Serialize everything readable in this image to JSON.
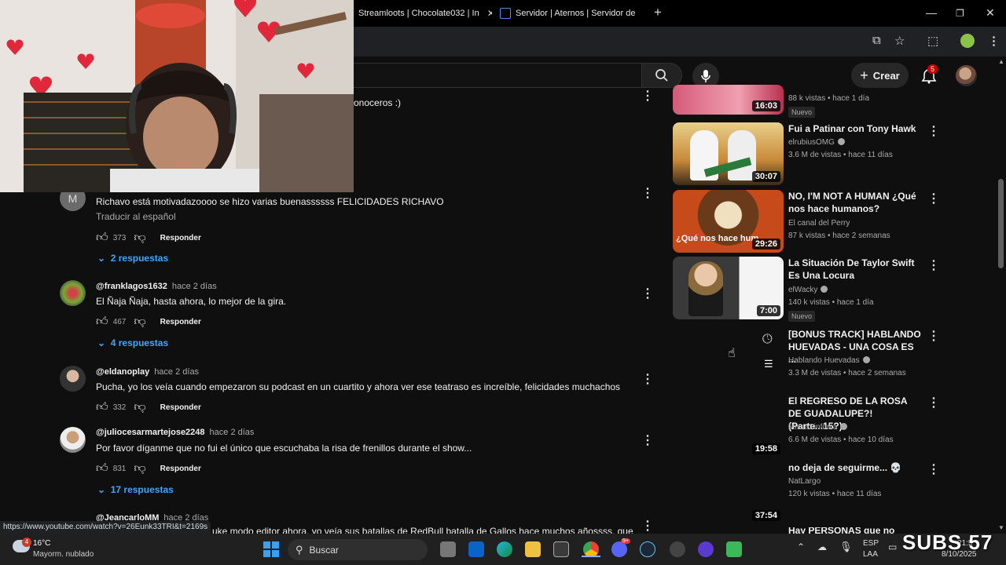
{
  "browser": {
    "tabs": [
      {
        "label": "Streamloots | Chocolate032 | In"
      },
      {
        "label": "Servidor | Aternos | Servidor de"
      }
    ],
    "new_tab_label": "+"
  },
  "youtube": {
    "create_label": "Crear",
    "notifications_count": "5",
    "partial_top_comment": "onoceros :)",
    "comments": [
      {
        "author": "",
        "time": "",
        "avatar_letter": "M",
        "text": "Richavo está motivadazoooo se hizo varias buenassssss FELICIDADES RICHAVO",
        "translate": "Traducir al español",
        "likes": "373",
        "reply_label": "Responder",
        "replies": "2 respuestas"
      },
      {
        "author": "@franklagos1632",
        "time": "hace 2 días",
        "text": "El Ñaja Ñaja, hasta ahora, lo mejor de la gira.",
        "likes": "467",
        "reply_label": "Responder",
        "replies": "4 respuestas"
      },
      {
        "author": "@eldanoplay",
        "time": "hace 2 días",
        "text": "Pucha, yo los veía cuando empezaron su podcast en un cuartito y ahora ver ese teatraso es increíble, felicidades muchachos",
        "likes": "332",
        "reply_label": "Responder",
        "replies": ""
      },
      {
        "author": "@juliocesarmartejose2248",
        "time": "hace 2 días",
        "text": "Por favor díganme que no fui el único que escuchaba la risa de frenillos durante el show...",
        "likes": "831",
        "reply_label": "Responder",
        "replies": "17 respuestas"
      },
      {
        "author": "@JeancarloMM",
        "time": "hace 2 días",
        "text": "uke modo editor ahora, yo veía sus batallas de RedBull batalla de Gallos hace muchos añossss, que",
        "likes": "",
        "reply_label": "",
        "replies": ""
      }
    ],
    "sidebar": [
      {
        "title": "",
        "channel": "",
        "meta": "88 k vistas • hace 1 día",
        "duration": "16:03",
        "badge": "Nuevo"
      },
      {
        "title": "Fui a Patinar con Tony Hawk",
        "channel": "elrubiusOMG",
        "meta": "3.6 M de vistas • hace 11 días",
        "duration": "30:07",
        "badge": ""
      },
      {
        "title": "NO, I'M NOT A HUMAN ¿Qué nos hace humanos?",
        "channel": "El canal del Perry",
        "meta": "87 k vistas • hace 2 semanas",
        "duration": "29:26",
        "badge": "",
        "thumb_text": "¿Qué nos hace hum"
      },
      {
        "title": "La Situación De Taylor Swift Es Una Locura",
        "channel": "elWacky",
        "meta": "140 k vistas • hace 1 día",
        "duration": "7:00",
        "badge": "Nuevo"
      },
      {
        "title": "[BONUS TRACK] HABLANDO HUEVADAS - UNA COSA ES ...",
        "channel": "Hablando Huevadas",
        "meta": "3.3 M de vistas • hace 2 semanas",
        "duration": "",
        "badge": ""
      },
      {
        "title": "El REGRESO DE LA ROSA DE GUADALUPE?! (Parte...15?)",
        "channel": "MissaSinfonia",
        "meta": "6.6 M de vistas • hace 10 días",
        "duration": "19:58",
        "badge": ""
      },
      {
        "title": "no deja de seguirme... 💀",
        "channel": "NatLargo",
        "meta": "120 k vistas • hace 11 días",
        "duration": "37:54",
        "badge": ""
      },
      {
        "title": "Hay PERSONAS que no LLEGAN a ...",
        "channel": "",
        "meta": "",
        "duration": "",
        "badge": ""
      }
    ]
  },
  "status_url": "https://www.youtube.com/watch?v=26Eunk33TRI&t=2169s",
  "taskbar": {
    "weather_temp": "16°C",
    "weather_desc": "Mayorm. nublado",
    "weather_badge": "4",
    "search_label": "Buscar",
    "lang_top": "ESP",
    "lang_bottom": "LAA",
    "clock_time": "21:5",
    "clock_date": "8/10/2025",
    "discord_badge": "9+",
    "overlay_text": "SUBS 57"
  }
}
